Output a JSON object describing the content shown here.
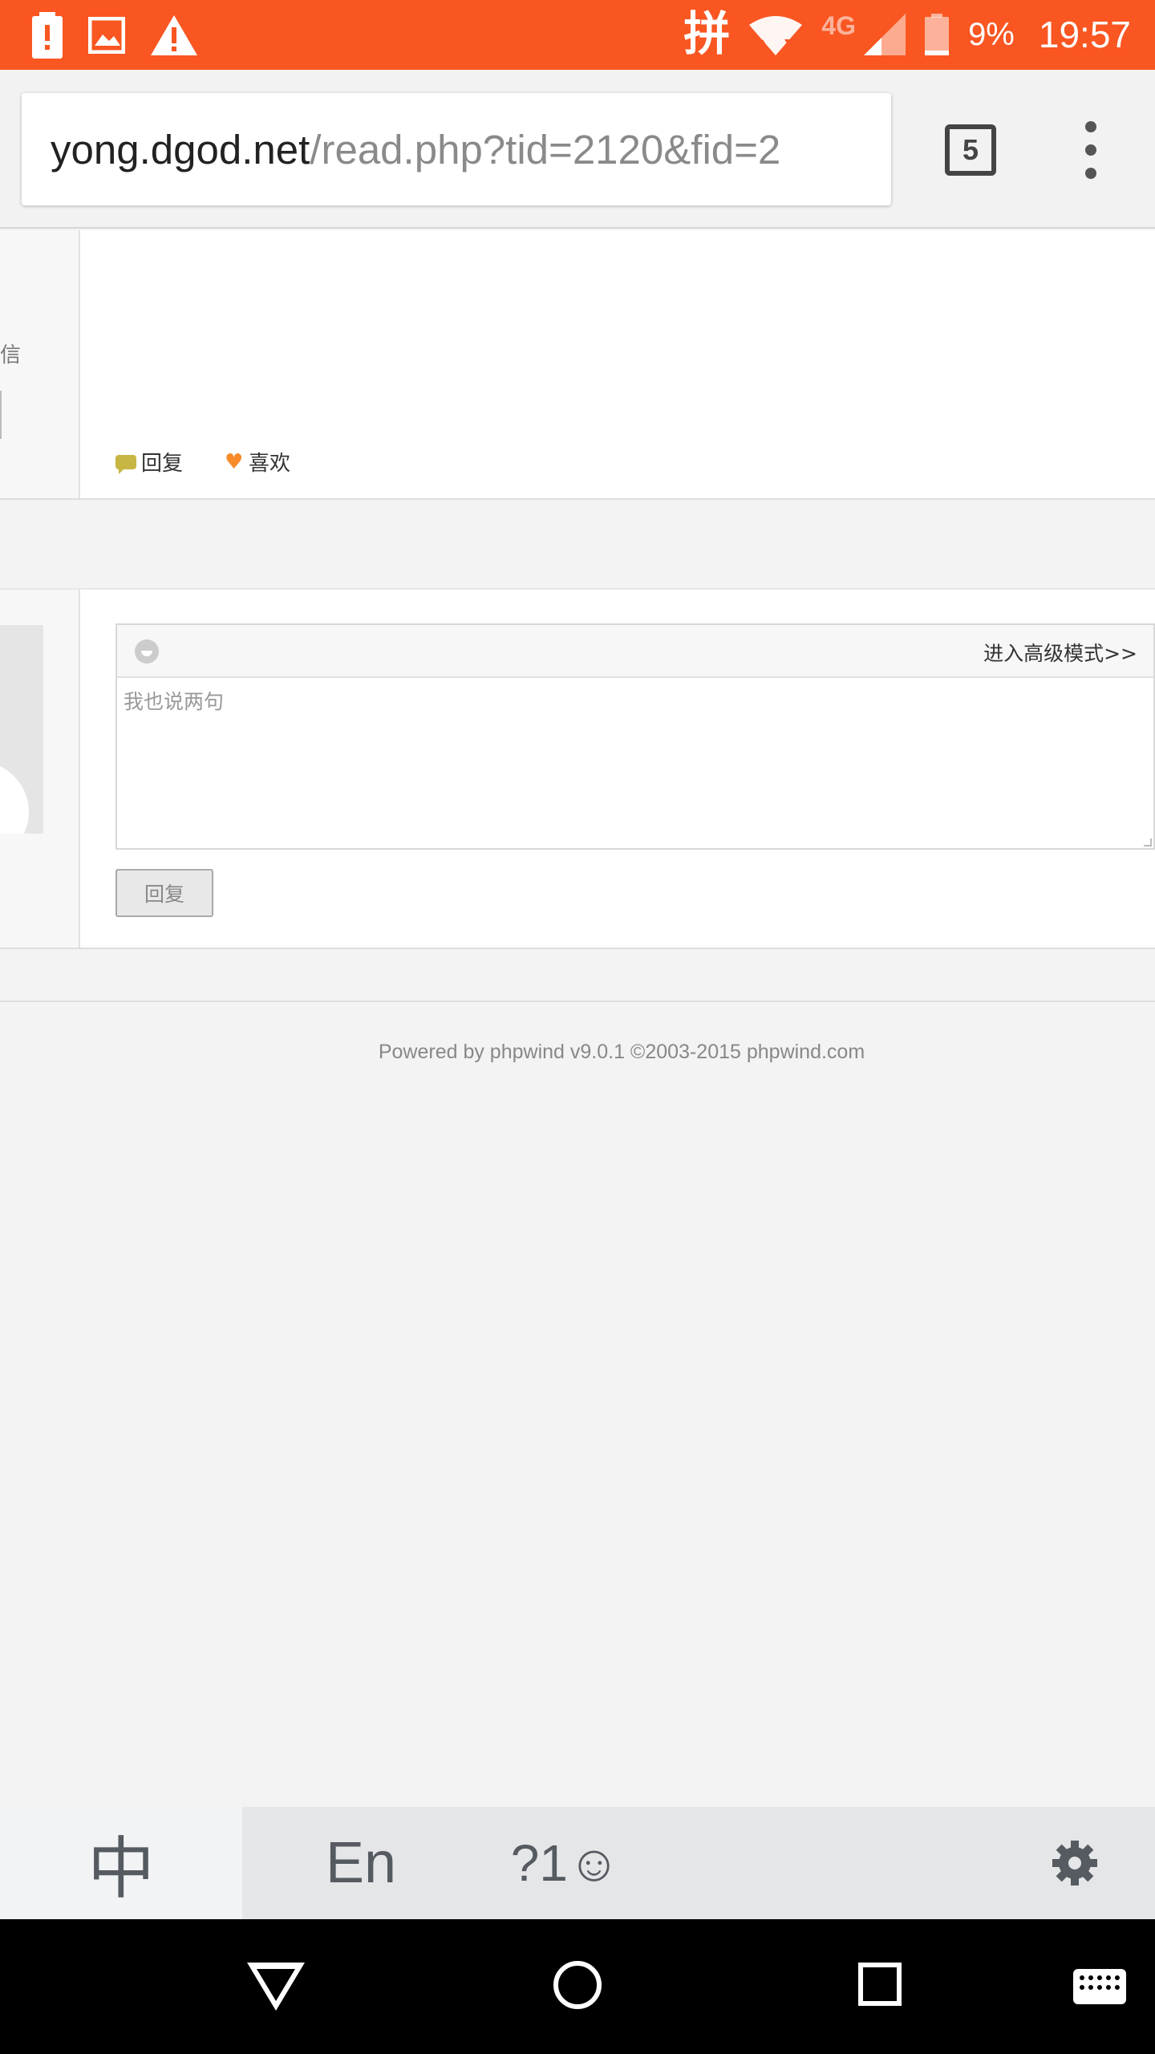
{
  "status_bar": {
    "ime_indicator": "拼",
    "network": "4G",
    "battery_percent": "9%",
    "time": "19:57",
    "icons": [
      "battery-alert-icon",
      "image-icon",
      "warning-icon",
      "wifi-icon",
      "signal-icon",
      "battery-icon"
    ]
  },
  "browser": {
    "url_host": "yong.dgod.net",
    "url_path": "/read.php?tid=2120&fid=2",
    "tab_count": "5"
  },
  "post": {
    "side_text": "私信",
    "reply_label": "回复",
    "like_label": "喜欢"
  },
  "reply_form": {
    "advanced_mode_link": "进入高级模式>>",
    "placeholder": "我也说两句",
    "submit_label": "回复"
  },
  "footer": {
    "text": "Powered by phpwind v9.0.1 ©2003-2015 phpwind.com"
  },
  "ime": {
    "chinese": "中",
    "english": "En",
    "symbols": "?1☺",
    "settings_icon": "gear-icon"
  },
  "colors": {
    "status_bar": "#f95621",
    "reply_icon": "#c7b642",
    "like_icon": "#f98a2a"
  }
}
